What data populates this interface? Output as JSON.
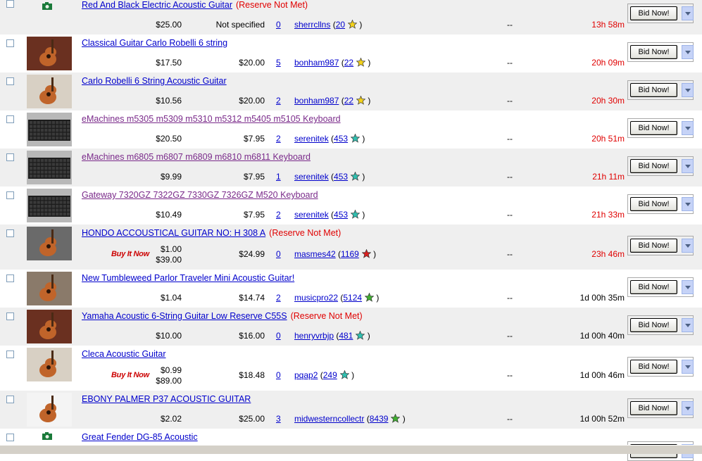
{
  "bid_button_label": "Bid Now!",
  "buy_it_now_label": "Buy It Now",
  "listings": [
    {
      "title": "Red And Black Electric Acoustic Guitar",
      "reserve": "(Reserve Not Met)",
      "price": "$25.00",
      "shipping": "Not specified",
      "bids": "0",
      "seller": "sherrcllns",
      "feedback": "20",
      "star_color": "#f4d21a",
      "dash": "--",
      "time_left": "13h 58m",
      "image": "camera-icon",
      "visited": false
    },
    {
      "title": "Classical Guitar Carlo Robelli 6 string",
      "reserve": "",
      "price": "$17.50",
      "shipping": "$20.00",
      "bids": "5",
      "seller": "bonham987",
      "feedback": "22",
      "star_color": "#f4d21a",
      "dash": "--",
      "time_left": "20h 09m",
      "image": "guitar-photo",
      "visited": false
    },
    {
      "title": "Carlo Robelli 6 String Acoustic Guitar",
      "reserve": "",
      "price": "$10.56",
      "shipping": "$20.00",
      "bids": "2",
      "seller": "bonham987",
      "feedback": "22",
      "star_color": "#f4d21a",
      "dash": "--",
      "time_left": "20h 30m",
      "image": "guitar-photo",
      "visited": false
    },
    {
      "title": "eMachines m5305 m5309 m5310 m5312 m5405 m5105 Keyboard",
      "reserve": "",
      "price": "$20.50",
      "shipping": "$7.95",
      "bids": "2",
      "seller": "serenitek",
      "feedback": "453",
      "star_color": "#30c0b0",
      "dash": "--",
      "time_left": "20h 51m",
      "image": "keyboard-photo",
      "visited": true
    },
    {
      "title": "eMachines m6805 m6807 m6809 m6810 m6811 Keyboard",
      "reserve": "",
      "price": "$9.99",
      "shipping": "$7.95",
      "bids": "1",
      "seller": "serenitek",
      "feedback": "453",
      "star_color": "#30c0b0",
      "dash": "--",
      "time_left": "21h 11m",
      "image": "keyboard-photo",
      "visited": true
    },
    {
      "title": "Gateway 7320GZ 7322GZ 7330GZ 7326GZ M520 Keyboard",
      "reserve": "",
      "price": "$10.49",
      "shipping": "$7.95",
      "bids": "2",
      "seller": "serenitek",
      "feedback": "453",
      "star_color": "#30c0b0",
      "dash": "--",
      "time_left": "21h 33m",
      "image": "keyboard-photo",
      "visited": true
    },
    {
      "title": "HONDO ACCOUSTICAL GUITAR NO: H 308 A",
      "reserve": "(Reserve Not Met)",
      "price": "$1.00",
      "buy_now_price": "$39.00",
      "shipping": "$24.99",
      "bids": "0",
      "seller": "masmes42",
      "feedback": "1169",
      "star_color": "#d82020",
      "dash": "--",
      "time_left": "23h 46m",
      "image": "guitar-photo",
      "visited": false
    },
    {
      "title": "New Tumbleweed Parlor Traveler Mini Acoustic Guitar!",
      "reserve": "",
      "price": "$1.04",
      "shipping": "$14.74",
      "bids": "2",
      "seller": "musicpro22",
      "feedback": "5124",
      "star_color": "#40b030",
      "dash": "--",
      "time_left": "1d 00h 35m",
      "image": "guitar-photo",
      "visited": false
    },
    {
      "title": "Yamaha Acoustic 6-String Guitar Low Reserve C55S",
      "reserve": "(Reserve Not Met)",
      "price": "$10.00",
      "shipping": "$16.00",
      "bids": "0",
      "seller": "henryvrbjp",
      "feedback": "481",
      "star_color": "#30c0b0",
      "dash": "--",
      "time_left": "1d 00h 40m",
      "image": "guitar-photo",
      "visited": false
    },
    {
      "title": "Cleca Acoustic Guitar",
      "reserve": "",
      "price": "$0.99",
      "buy_now_price": "$89.00",
      "shipping": "$18.48",
      "bids": "0",
      "seller": "pqap2",
      "feedback": "249",
      "star_color": "#30c0b0",
      "dash": "--",
      "time_left": "1d 00h 46m",
      "image": "guitar-photo",
      "visited": false
    },
    {
      "title": "EBONY PALMER P37 ACOUSTIC GUITAR",
      "reserve": "",
      "price": "$2.02",
      "shipping": "$25.00",
      "bids": "3",
      "seller": "midwesterncollectr",
      "feedback": "8439",
      "star_color": "#40b030",
      "dash": "--",
      "time_left": "1d 00h 52m",
      "image": "guitar-photo",
      "visited": false
    },
    {
      "title": "Great Fender DG-85 Acoustic",
      "reserve": "",
      "image": "camera-icon",
      "visited": false,
      "partial": true
    }
  ]
}
